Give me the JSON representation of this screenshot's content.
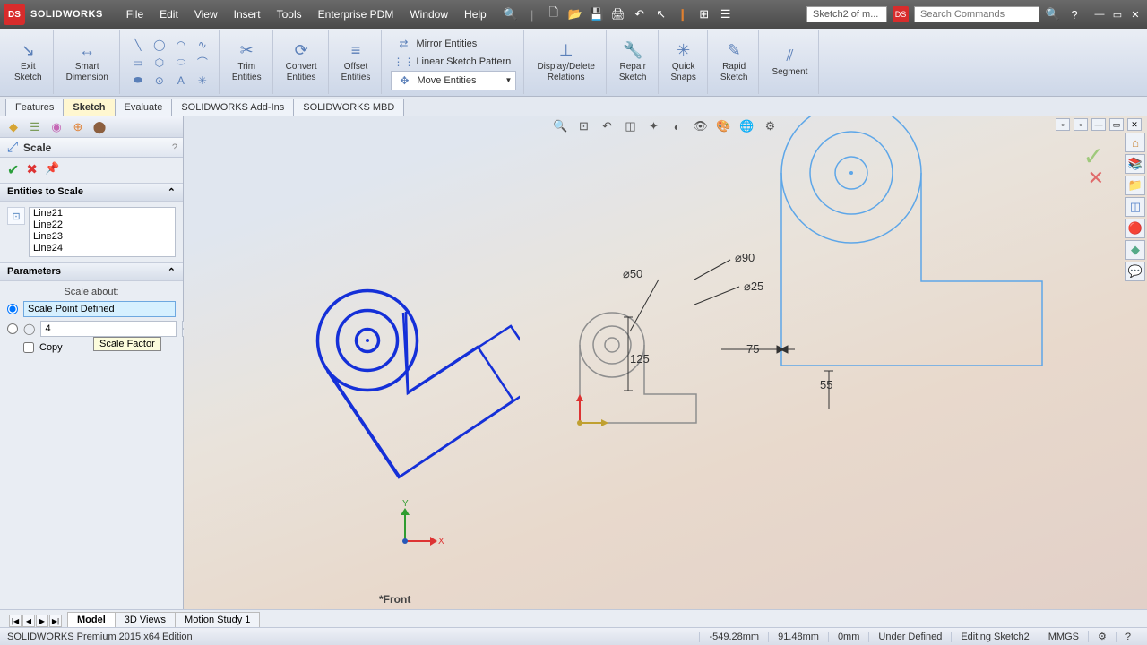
{
  "brand": "SOLIDWORKS",
  "menubar": [
    "File",
    "Edit",
    "View",
    "Insert",
    "Tools",
    "Enterprise PDM",
    "Window",
    "Help"
  ],
  "doc_name": "Sketch2 of m...",
  "search_placeholder": "Search Commands",
  "ribbon": {
    "exit_sketch": "Exit\nSketch",
    "smart_dimension": "Smart\nDimension",
    "trim_entities": "Trim\nEntities",
    "convert_entities": "Convert\nEntities",
    "offset_entities": "Offset\nEntities",
    "mirror_entities": "Mirror Entities",
    "linear_pattern": "Linear Sketch Pattern",
    "move_entities": "Move Entities",
    "display_delete": "Display/Delete\nRelations",
    "repair_sketch": "Repair\nSketch",
    "quick_snaps": "Quick\nSnaps",
    "rapid_sketch": "Rapid\nSketch",
    "segment": "Segment"
  },
  "cmdtabs": [
    "Features",
    "Sketch",
    "Evaluate",
    "SOLIDWORKS Add-Ins",
    "SOLIDWORKS MBD"
  ],
  "cmdtab_active": 1,
  "pm": {
    "title": "Scale",
    "section_entities": "Entities to Scale",
    "entities": [
      "Line21",
      "Line22",
      "Line23",
      "Line24"
    ],
    "section_params": "Parameters",
    "scale_about_label": "Scale about:",
    "scale_about_value": "Scale Point Defined",
    "scale_factor_value": "4",
    "scale_factor_tooltip": "Scale Factor",
    "copy_label": "Copy"
  },
  "dims": {
    "d50": "⌀50",
    "d90": "⌀90",
    "d25": "⌀25",
    "l125": "125",
    "l75": "75",
    "l55": "55"
  },
  "view_label": "*Front",
  "triad": {
    "x": "X",
    "y": "Y"
  },
  "model_tabs": [
    "Model",
    "3D Views",
    "Motion Study 1"
  ],
  "status": {
    "edition": "SOLIDWORKS Premium 2015 x64 Edition",
    "x": "-549.28mm",
    "y": "91.48mm",
    "z": "0mm",
    "defined": "Under Defined",
    "mode": "Editing Sketch2",
    "units": "MMGS"
  }
}
